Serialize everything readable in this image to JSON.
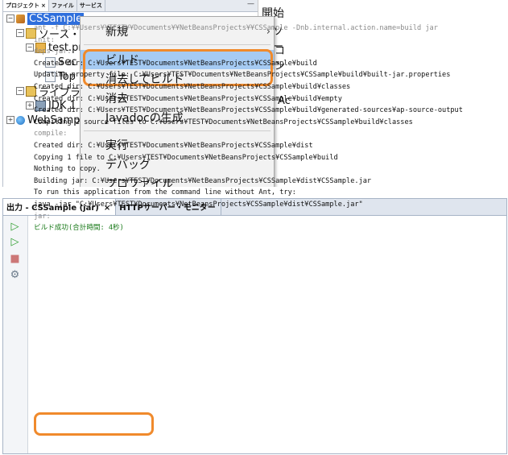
{
  "project_panel": {
    "tabs": [
      "プロジェクト",
      "ファイル",
      "サービス"
    ],
    "tab_close": "×",
    "minimize": "—",
    "tree": [
      {
        "label": "CSSample",
        "toggle": "−",
        "icon": "project-icon"
      },
      {
        "label": "ソース・パ",
        "toggle": "−",
        "icon": "folder-icon"
      },
      {
        "label": "test.pr",
        "toggle": "−",
        "icon": "package-icon"
      },
      {
        "label": "Sec",
        "toggle": "",
        "icon": "java-file-icon"
      },
      {
        "label": "Top",
        "toggle": "",
        "icon": "java-file-icon"
      },
      {
        "label": "ライブラリ",
        "toggle": "−",
        "icon": "library-icon"
      },
      {
        "label": "JDK 1",
        "toggle": "+",
        "icon": "jdk-icon"
      },
      {
        "label": "WebSamp",
        "toggle": "+",
        "icon": "web-project-icon"
      }
    ]
  },
  "editor": {
    "tab_label": "開始",
    "fragments": [
      "ソー",
      "コン",
      "Ac"
    ]
  },
  "context_menu": {
    "items": [
      {
        "label": "新規",
        "submenu_arrow": "›"
      },
      {
        "label": "ビルド"
      },
      {
        "label": "消去してビルド"
      },
      {
        "label": "消去"
      },
      {
        "label": "Javadocの生成"
      },
      {
        "label": "実行"
      },
      {
        "label": "デバッグ"
      },
      {
        "label": "プロファイル"
      }
    ]
  },
  "output_window": {
    "tabs": [
      {
        "label": "出力 - CSSample (jar)",
        "close": "×"
      },
      {
        "label": "HTTPサーバー・モニター"
      }
    ],
    "lines": [
      {
        "text": "ant -f C:¥¥Users¥¥TEST¥¥Documents¥¥NetBeansProjects¥¥CSSample -Dnb.internal.action.name=build jar",
        "style": "gray"
      },
      {
        "text": "init:",
        "style": "gray"
      },
      {
        "text": "deps-jar:",
        "style": "gray"
      },
      {
        "text": "Created dir: C:¥Users¥TEST¥Documents¥NetBeansProjects¥CSSample¥build",
        "style": "normal"
      },
      {
        "text": "Updating property file: C:¥Users¥TEST¥Documents¥NetBeansProjects¥CSSample¥build¥built-jar.properties",
        "style": "normal"
      },
      {
        "text": "Created dir: C:¥Users¥TEST¥Documents¥NetBeansProjects¥CSSample¥build¥classes",
        "style": "normal"
      },
      {
        "text": "Created dir: C:¥Users¥TEST¥Documents¥NetBeansProjects¥CSSample¥build¥empty",
        "style": "normal"
      },
      {
        "text": "Created dir: C:¥Users¥TEST¥Documents¥NetBeansProjects¥CSSample¥build¥generated-sources¥ap-source-output",
        "style": "normal"
      },
      {
        "text": "Compiling 2 source files to C:¥Users¥TEST¥Documents¥NetBeansProjects¥CSSample¥build¥classes",
        "style": "normal"
      },
      {
        "text": "compile:",
        "style": "gray"
      },
      {
        "text": "Created dir: C:¥Users¥TEST¥Documents¥NetBeansProjects¥CSSample¥dist",
        "style": "normal"
      },
      {
        "text": "Copying 1 file to C:¥Users¥TEST¥Documents¥NetBeansProjects¥CSSample¥build",
        "style": "normal"
      },
      {
        "text": "Nothing to copy.",
        "style": "normal"
      },
      {
        "text": "Building jar: C:¥Users¥TEST¥Documents¥NetBeansProjects¥CSSample¥dist¥CSSample.jar",
        "style": "normal"
      },
      {
        "text": "To run this application from the command line without Ant, try:",
        "style": "normal"
      },
      {
        "text": "java -jar \"C:¥Users¥TEST¥Documents¥NetBeansProjects¥CSSample¥dist¥CSSample.jar\"",
        "style": "normal"
      },
      {
        "text": "jar:",
        "style": "gray"
      },
      {
        "text": "ビルド成功(合計時間: 4秒)",
        "style": "green"
      }
    ],
    "side_buttons": [
      {
        "name": "rerun-icon",
        "glyph": "▷",
        "color": "#2e9e2e"
      },
      {
        "name": "rerun-with-params-icon",
        "glyph": "▷",
        "color": "#2e9e2e"
      },
      {
        "name": "stop-icon",
        "glyph": "■",
        "color": "#c77"
      },
      {
        "name": "settings-icon",
        "glyph": "⚙",
        "color": "#6a7a8a"
      }
    ]
  },
  "colors": {
    "highlight_ring": "#f08a2c",
    "menu_hover": "#a6cbf3",
    "selection": "#2f6fdc",
    "success_text": "#1a7a1a"
  }
}
